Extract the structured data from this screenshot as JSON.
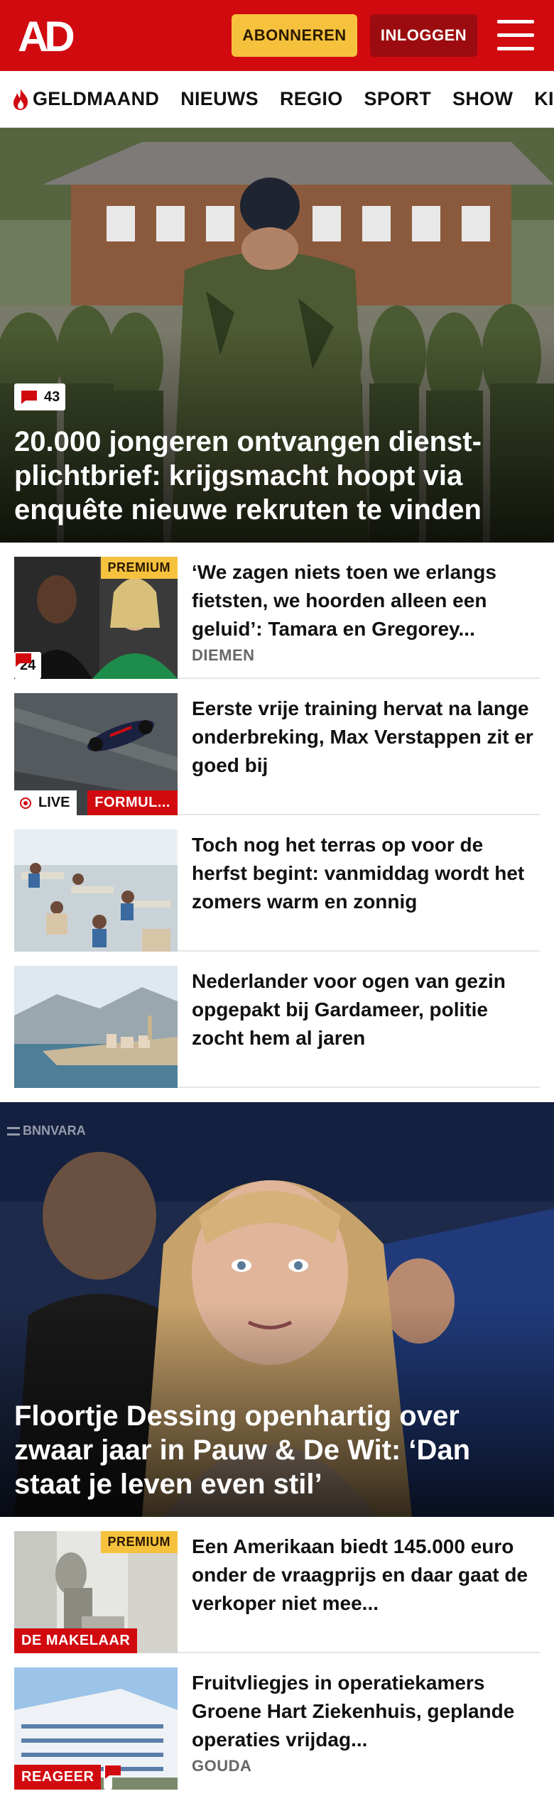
{
  "header": {
    "logo_text": "AD",
    "subscribe_label": "ABONNEREN",
    "login_label": "INLOGGEN",
    "menu_icon": "hamburger-icon",
    "brand_color": "#d10a10",
    "accent_color": "#f6c23d"
  },
  "nav": {
    "items": [
      {
        "label": "GELDMAAND",
        "icon": "flame-icon"
      },
      {
        "label": "NIEUWS"
      },
      {
        "label": "REGIO"
      },
      {
        "label": "SPORT"
      },
      {
        "label": "SHOW"
      },
      {
        "label": "KIJK"
      }
    ]
  },
  "hero": {
    "comments": "43",
    "title": "20.000 jongeren ontvangen dienst­plichtbrief: krijgsmacht hoopt via enquête nieuwe rekruten te vinden"
  },
  "articles": [
    {
      "title": "‘We zagen niets toen we erlangs fietsten, we hoorden alleen een geluid’: Tamara en Gregorey...",
      "meta": "DIEMEN",
      "premium": "PREMIUM",
      "comments": "24"
    },
    {
      "title": "Eerste vrije training hervat na lange onderbreking, Max Verstappen zit er goed bij",
      "live": "LIVE",
      "category": "FORMUL..."
    },
    {
      "title": "Toch nog het terras op voor de herfst begint: vanmiddag wordt het zomers warm en zonnig"
    },
    {
      "title": "Nederlander voor ogen van gezin opgepakt bij Gardameer, politie zocht hem al jaren"
    }
  ],
  "hero2": {
    "watermark": "BNNVARA",
    "title": "Floortje Dessing openhartig over zwaar jaar in Pauw & De Wit: ‘Dan staat je leven even stil’"
  },
  "articles2": [
    {
      "title": "Een Amerikaan biedt 145.000 euro onder de vraagprijs en daar gaat de verkoper niet mee...",
      "premium": "PREMIUM",
      "category": "DE MAKELAAR"
    },
    {
      "title": "Fruitvliegjes in operatiekamers Groene Hart Ziekenhuis, geplande operaties vrijdag...",
      "meta": "GOUDA",
      "category": "REAGEER"
    }
  ]
}
